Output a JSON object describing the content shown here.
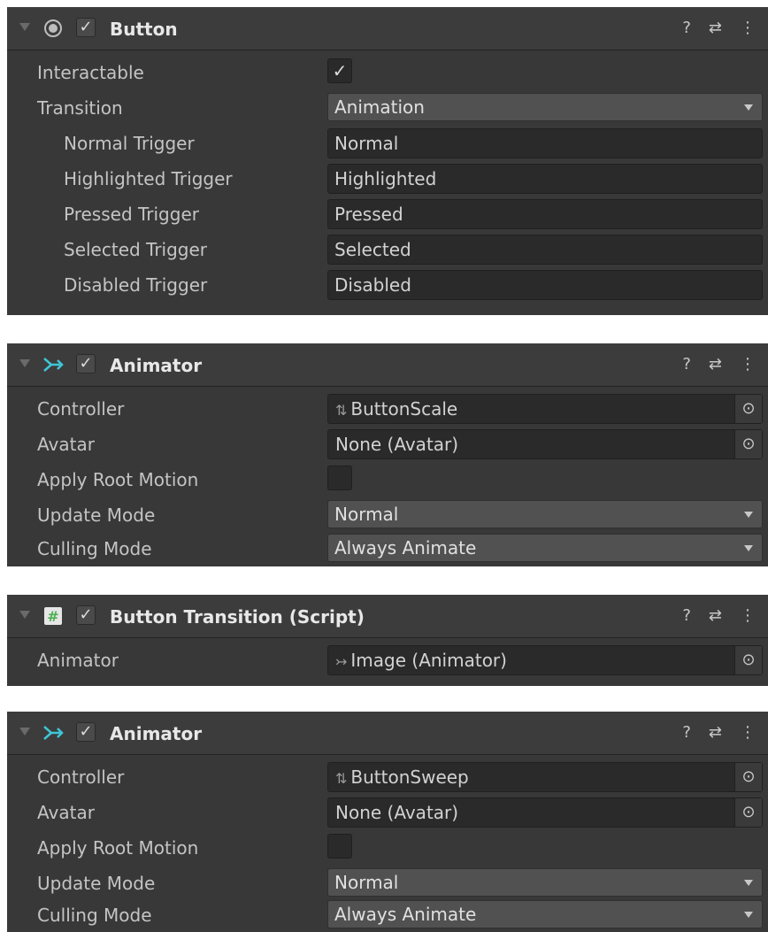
{
  "panels": [
    {
      "title": "Button",
      "rows": [
        {
          "label": "Interactable"
        },
        {
          "label": "Transition",
          "value": "Animation"
        },
        {
          "label": "Normal Trigger",
          "value": "Normal"
        },
        {
          "label": "Highlighted Trigger",
          "value": "Highlighted"
        },
        {
          "label": "Pressed Trigger",
          "value": "Pressed"
        },
        {
          "label": "Selected Trigger",
          "value": "Selected"
        },
        {
          "label": "Disabled Trigger",
          "value": "Disabled"
        }
      ]
    },
    {
      "title": "Animator",
      "rows": [
        {
          "label": "Controller",
          "value": "ButtonScale"
        },
        {
          "label": "Avatar",
          "value": "None (Avatar)"
        },
        {
          "label": "Apply Root Motion"
        },
        {
          "label": "Update Mode",
          "value": "Normal"
        },
        {
          "label": "Culling Mode",
          "value": "Always Animate"
        }
      ]
    },
    {
      "title": "Button Transition (Script)",
      "rows": [
        {
          "label": "Animator",
          "value": "Image (Animator)"
        }
      ]
    },
    {
      "title": "Animator",
      "rows": [
        {
          "label": "Controller",
          "value": "ButtonSweep"
        },
        {
          "label": "Avatar",
          "value": "None (Avatar)"
        },
        {
          "label": "Apply Root Motion"
        },
        {
          "label": "Update Mode",
          "value": "Normal"
        },
        {
          "label": "Culling Mode",
          "value": "Always Animate"
        }
      ]
    }
  ],
  "glyphs": {
    "check": "✓",
    "help": "?",
    "settings": "⇄",
    "more": "⋮",
    "pick": "⊙",
    "controller": "⇅",
    "animator": "↣",
    "script": "#"
  },
  "colors": {
    "panel_bg": "#383838",
    "header_bg": "#3c3c3c",
    "field_bg": "#2a2a2a",
    "dropdown_bg": "#515151",
    "animator_icon": "#3fc6d6",
    "script_icon": "#4caf50"
  }
}
